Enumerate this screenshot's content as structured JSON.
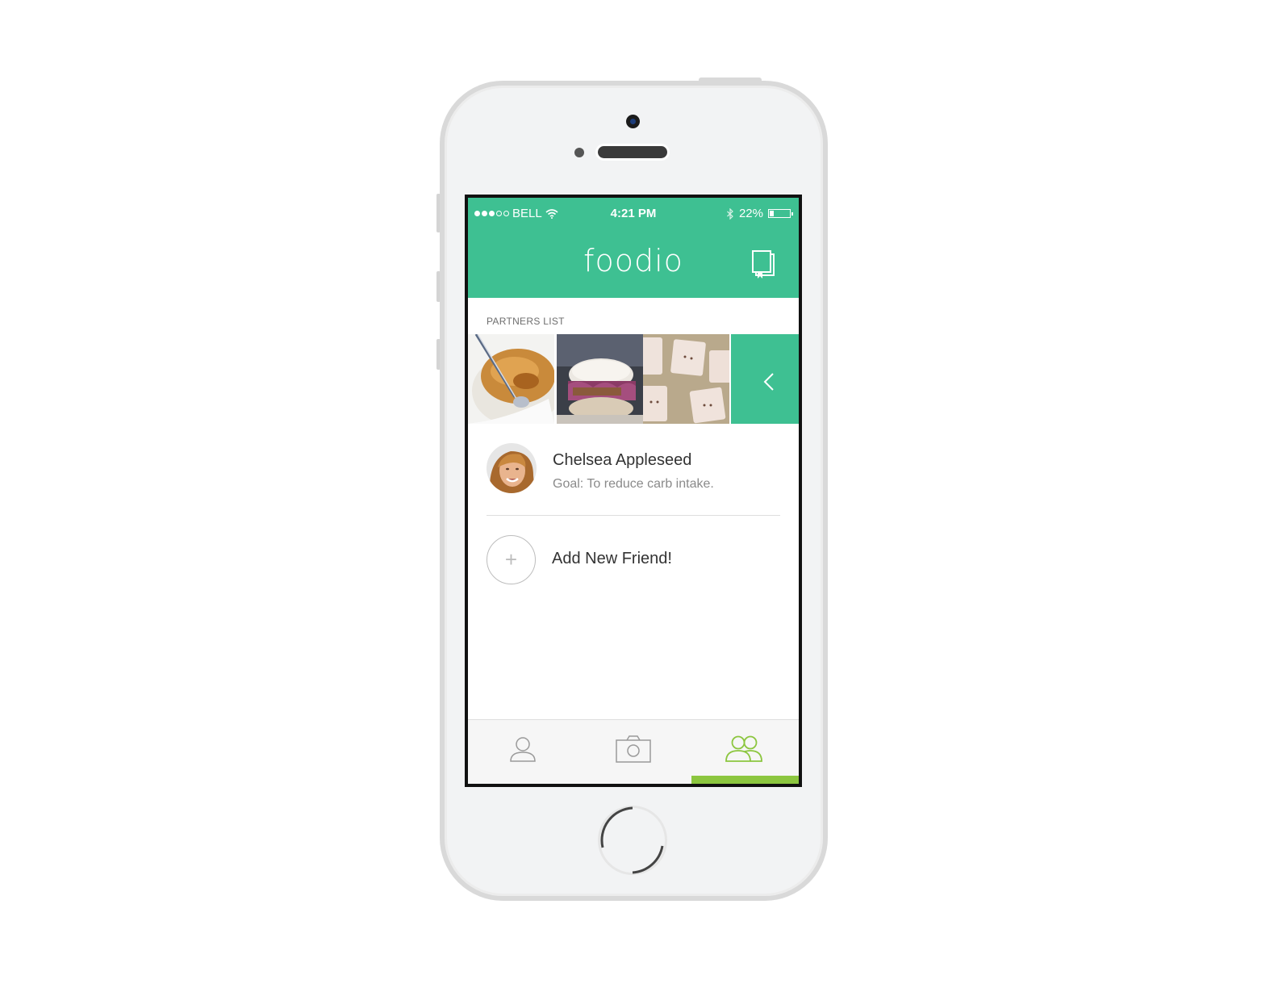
{
  "status_bar": {
    "carrier": "BELL",
    "time": "4:21 PM",
    "battery_percent_label": "22%",
    "battery_level": 0.22
  },
  "header": {
    "app_title": "foodio",
    "right_icon": "book-bookmark-icon"
  },
  "partners": {
    "section_label": "PARTNERS LIST",
    "photos": [
      "creme-brulee",
      "pulled-pork-sandwich",
      "pop-tarts"
    ],
    "collapse_icon": "chevron-left-icon"
  },
  "friends": [
    {
      "name": "Chelsea Appleseed",
      "goal": "Goal: To reduce carb intake."
    }
  ],
  "add_friend": {
    "icon": "+",
    "label": "Add New Friend!"
  },
  "tabbar": {
    "tabs": [
      {
        "icon": "profile-icon",
        "active": false
      },
      {
        "icon": "camera-icon",
        "active": false
      },
      {
        "icon": "friends-icon",
        "active": true
      }
    ]
  },
  "colors": {
    "brand_green": "#3ec092",
    "active_tab": "#8cc63f"
  }
}
